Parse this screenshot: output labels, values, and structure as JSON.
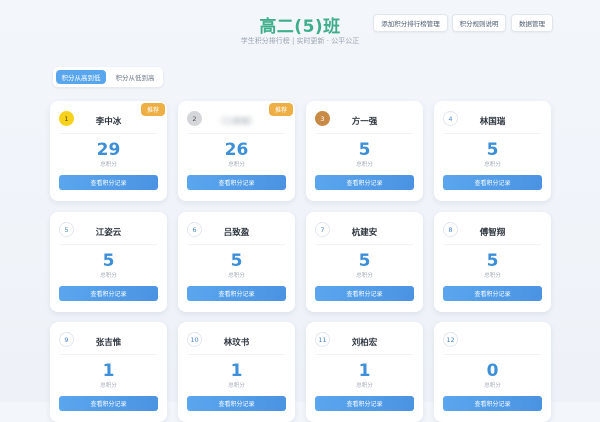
{
  "header": {
    "title": "高二(5)班",
    "subtitle": "学生积分排行榜 | 实时更新 · 公平公正",
    "buttons": [
      {
        "label": "添加积分排行榜管理"
      },
      {
        "label": "积分规则说明"
      },
      {
        "label": "数据管理"
      }
    ]
  },
  "toggle": {
    "options": [
      {
        "label": "积分从高到低"
      },
      {
        "label": "积分从低到高"
      }
    ],
    "active": 0
  },
  "card_common": {
    "score_label": "总积分",
    "record_button": "查看积分记录",
    "top_tag": "推荐"
  },
  "students": [
    {
      "rank": "1",
      "name": "李中冰",
      "score": "29",
      "medal": "gold",
      "tag": true
    },
    {
      "rank": "2",
      "name": "（已模糊）",
      "score": "26",
      "medal": "silver",
      "tag": true,
      "blurred": true
    },
    {
      "rank": "3",
      "name": "方一强",
      "score": "5",
      "medal": "bronze"
    },
    {
      "rank": "4",
      "name": "林国瑞",
      "score": "5"
    },
    {
      "rank": "5",
      "name": "江姿云",
      "score": "5"
    },
    {
      "rank": "6",
      "name": "吕致盈",
      "score": "5"
    },
    {
      "rank": "7",
      "name": "杭建安",
      "score": "5"
    },
    {
      "rank": "8",
      "name": "傅智翔",
      "score": "5"
    },
    {
      "rank": "9",
      "name": "张吉惟",
      "score": "1"
    },
    {
      "rank": "10",
      "name": "林玟书",
      "score": "1"
    },
    {
      "rank": "11",
      "name": "刘柏宏",
      "score": "1"
    },
    {
      "rank": "12",
      "name": "",
      "score": "0"
    }
  ]
}
